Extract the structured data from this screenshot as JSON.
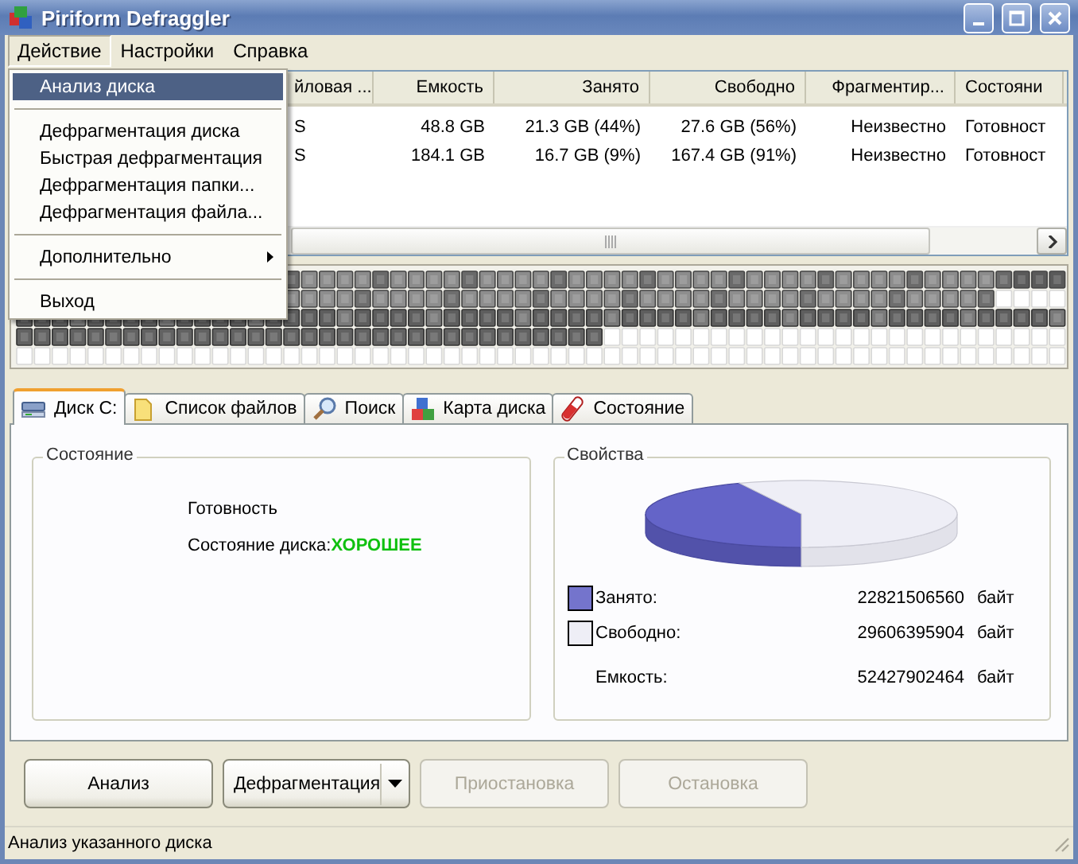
{
  "window": {
    "title": "Piriform Defraggler"
  },
  "menu_bar": [
    {
      "label": "Действие",
      "selected": true
    },
    {
      "label": "Настройки",
      "selected": false
    },
    {
      "label": "Справка",
      "selected": false
    }
  ],
  "open_menu": {
    "items": [
      {
        "kind": "item",
        "label": "Анализ диска",
        "selected": true
      },
      {
        "kind": "separator"
      },
      {
        "kind": "item",
        "label": "Дефрагментация диска",
        "selected": false
      },
      {
        "kind": "item",
        "label": "Быстрая дефрагментация",
        "selected": false
      },
      {
        "kind": "item",
        "label": "Дефрагментация папки...",
        "selected": false
      },
      {
        "kind": "item",
        "label": "Дефрагментация файла...",
        "selected": false
      },
      {
        "kind": "separator"
      },
      {
        "kind": "submenu",
        "label": "Дополнительно",
        "selected": false
      },
      {
        "kind": "separator"
      },
      {
        "kind": "item",
        "label": "Выход",
        "selected": false
      }
    ]
  },
  "drive_list": {
    "columns": [
      "йловая ...",
      "Емкость",
      "Занято",
      "Свободно",
      "Фрагментир...",
      "Состояни"
    ],
    "rows": [
      [
        "S",
        "48.8 GB",
        "21.3 GB (44%)",
        "27.6 GB (56%)",
        "Неизвестно",
        "Готовност"
      ],
      [
        "S",
        "184.1 GB",
        "16.7 GB (9%)",
        "167.4 GB (91%)",
        "Неизвестно",
        "Готовност"
      ]
    ]
  },
  "tabs": [
    {
      "label": "Диск C:",
      "selected": true
    },
    {
      "label": "Список файлов",
      "selected": false
    },
    {
      "label": "Поиск",
      "selected": false
    },
    {
      "label": "Карта диска",
      "selected": false
    },
    {
      "label": "Состояние",
      "selected": false
    }
  ],
  "status_group": {
    "title": "Состояние",
    "status": "Готовность",
    "health_label": "Состояние диска:",
    "health_value": "ХОРОШЕЕ"
  },
  "properties_group": {
    "title": "Свойства",
    "legend": [
      {
        "label": "Занято:",
        "value": "22821506560",
        "unit": "байт",
        "color": "#7474cc"
      },
      {
        "label": "Свободно:",
        "value": "29606395904",
        "unit": "байт",
        "color": "#eeeef6"
      }
    ],
    "capacity": {
      "label": "Емкость:",
      "value": "52427902464",
      "unit": "байт"
    }
  },
  "buttons": [
    {
      "kind": "button",
      "label": "Анализ",
      "disabled": false
    },
    {
      "kind": "split",
      "label": "Дефрагментация",
      "disabled": false
    },
    {
      "kind": "button",
      "label": "Приостановка",
      "disabled": true
    },
    {
      "kind": "button",
      "label": "Остановка",
      "disabled": true
    }
  ],
  "status_bar": "Анализ указанного диска"
}
